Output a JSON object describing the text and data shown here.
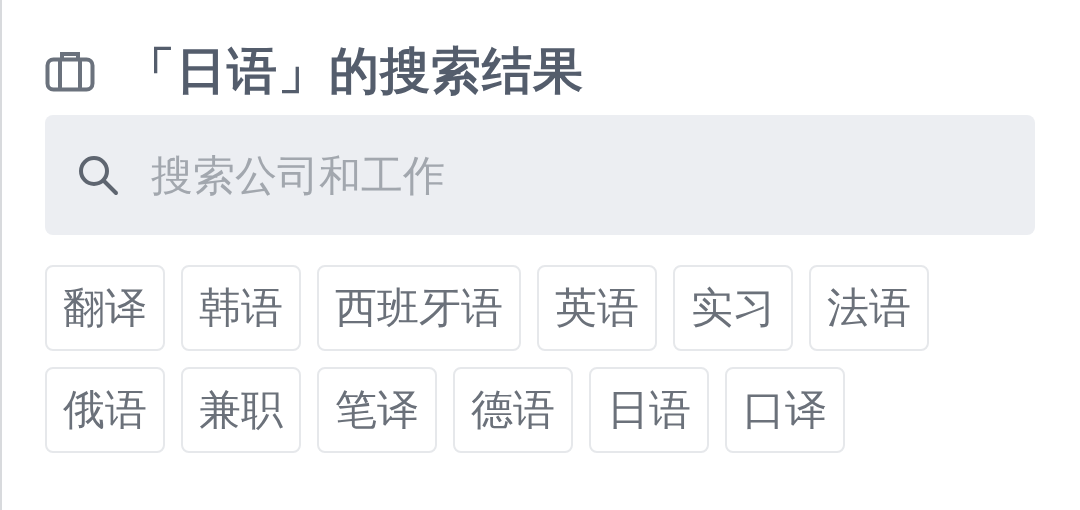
{
  "header": {
    "title": "「日语」的搜索结果"
  },
  "search": {
    "placeholder": "搜索公司和工作"
  },
  "tags": [
    {
      "label": "翻译"
    },
    {
      "label": "韩语"
    },
    {
      "label": "西班牙语"
    },
    {
      "label": "英语"
    },
    {
      "label": "实习"
    },
    {
      "label": "法语"
    },
    {
      "label": "俄语"
    },
    {
      "label": "兼职"
    },
    {
      "label": "笔译"
    },
    {
      "label": "德语"
    },
    {
      "label": "日语"
    },
    {
      "label": "口译"
    }
  ]
}
